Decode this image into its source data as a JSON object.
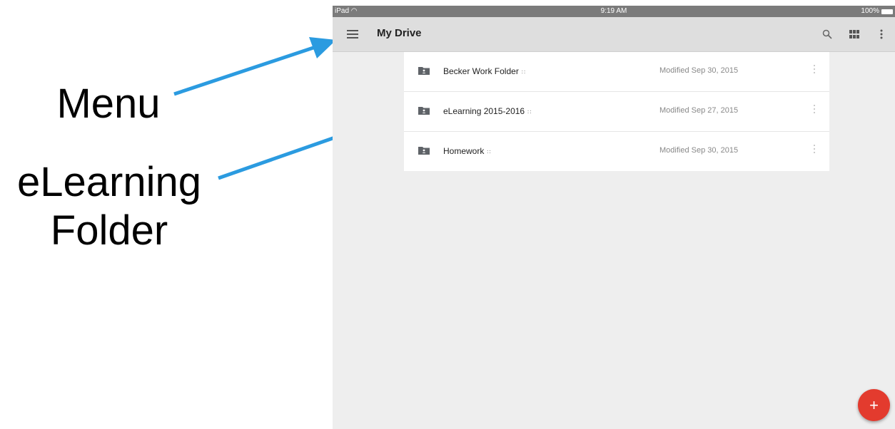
{
  "annotations": {
    "menu": "Menu",
    "elearning_line1": "eLearning",
    "elearning_line2": "Folder"
  },
  "statusbar": {
    "device": "iPad",
    "time": "9:19 AM",
    "battery": "100%"
  },
  "appbar": {
    "title": "My Drive",
    "icons": [
      "menu-icon",
      "search-icon",
      "grid-view-icon",
      "more-vert-icon"
    ]
  },
  "folders": [
    {
      "name": "Becker Work Folder",
      "shared_icon": "shared-icon",
      "modified": "Modified Sep 30, 2015"
    },
    {
      "name": "eLearning 2015-2016",
      "shared_icon": "shared-icon",
      "modified": "Modified Sep 27, 2015"
    },
    {
      "name": "Homework",
      "shared_icon": "shared-icon",
      "modified": "Modified Sep 30, 2015"
    }
  ],
  "fab": {
    "label": "+",
    "color": "#e33b2e"
  },
  "colors": {
    "arrow": "#2b9be0",
    "appbar": "#dedede",
    "background": "#eeeeee"
  }
}
